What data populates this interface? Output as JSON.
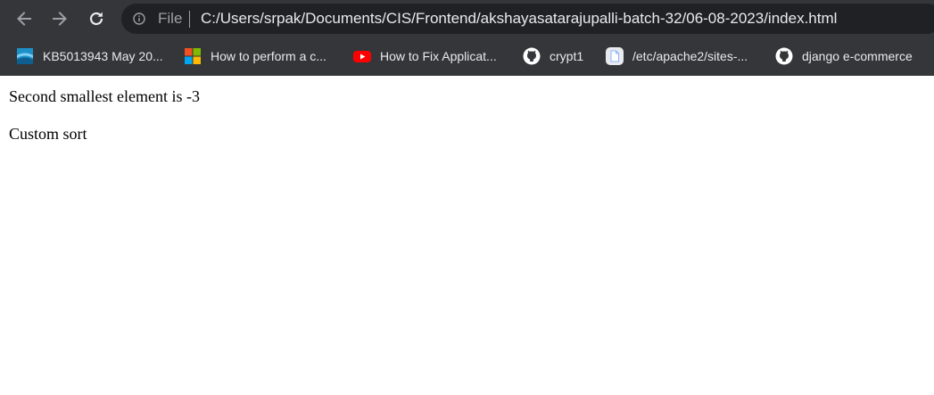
{
  "browser": {
    "address_bar": {
      "scheme_label": "File",
      "url": "C:/Users/srpak/Documents/CIS/Frontend/akshayasatarajupalli-batch-32/06-08-2023/index.html"
    },
    "bookmarks": [
      {
        "label": "KB5013943 May 20...",
        "icon": "kb-icon"
      },
      {
        "label": "How to perform a c...",
        "icon": "microsoft-icon"
      },
      {
        "label": "How to Fix Applicat...",
        "icon": "youtube-icon"
      },
      {
        "label": "crypt1",
        "icon": "github-icon"
      },
      {
        "label": "/etc/apache2/sites-...",
        "icon": "document-icon"
      },
      {
        "label": "django e-commerce",
        "icon": "github-icon"
      }
    ]
  },
  "page": {
    "paragraphs": [
      "Second smallest element is -3",
      "Custom sort"
    ]
  },
  "colors": {
    "chrome_bg": "#35363a",
    "omnibox_bg": "#202124",
    "youtube_red": "#ff0000",
    "kb_blue": "#1e90c8"
  }
}
